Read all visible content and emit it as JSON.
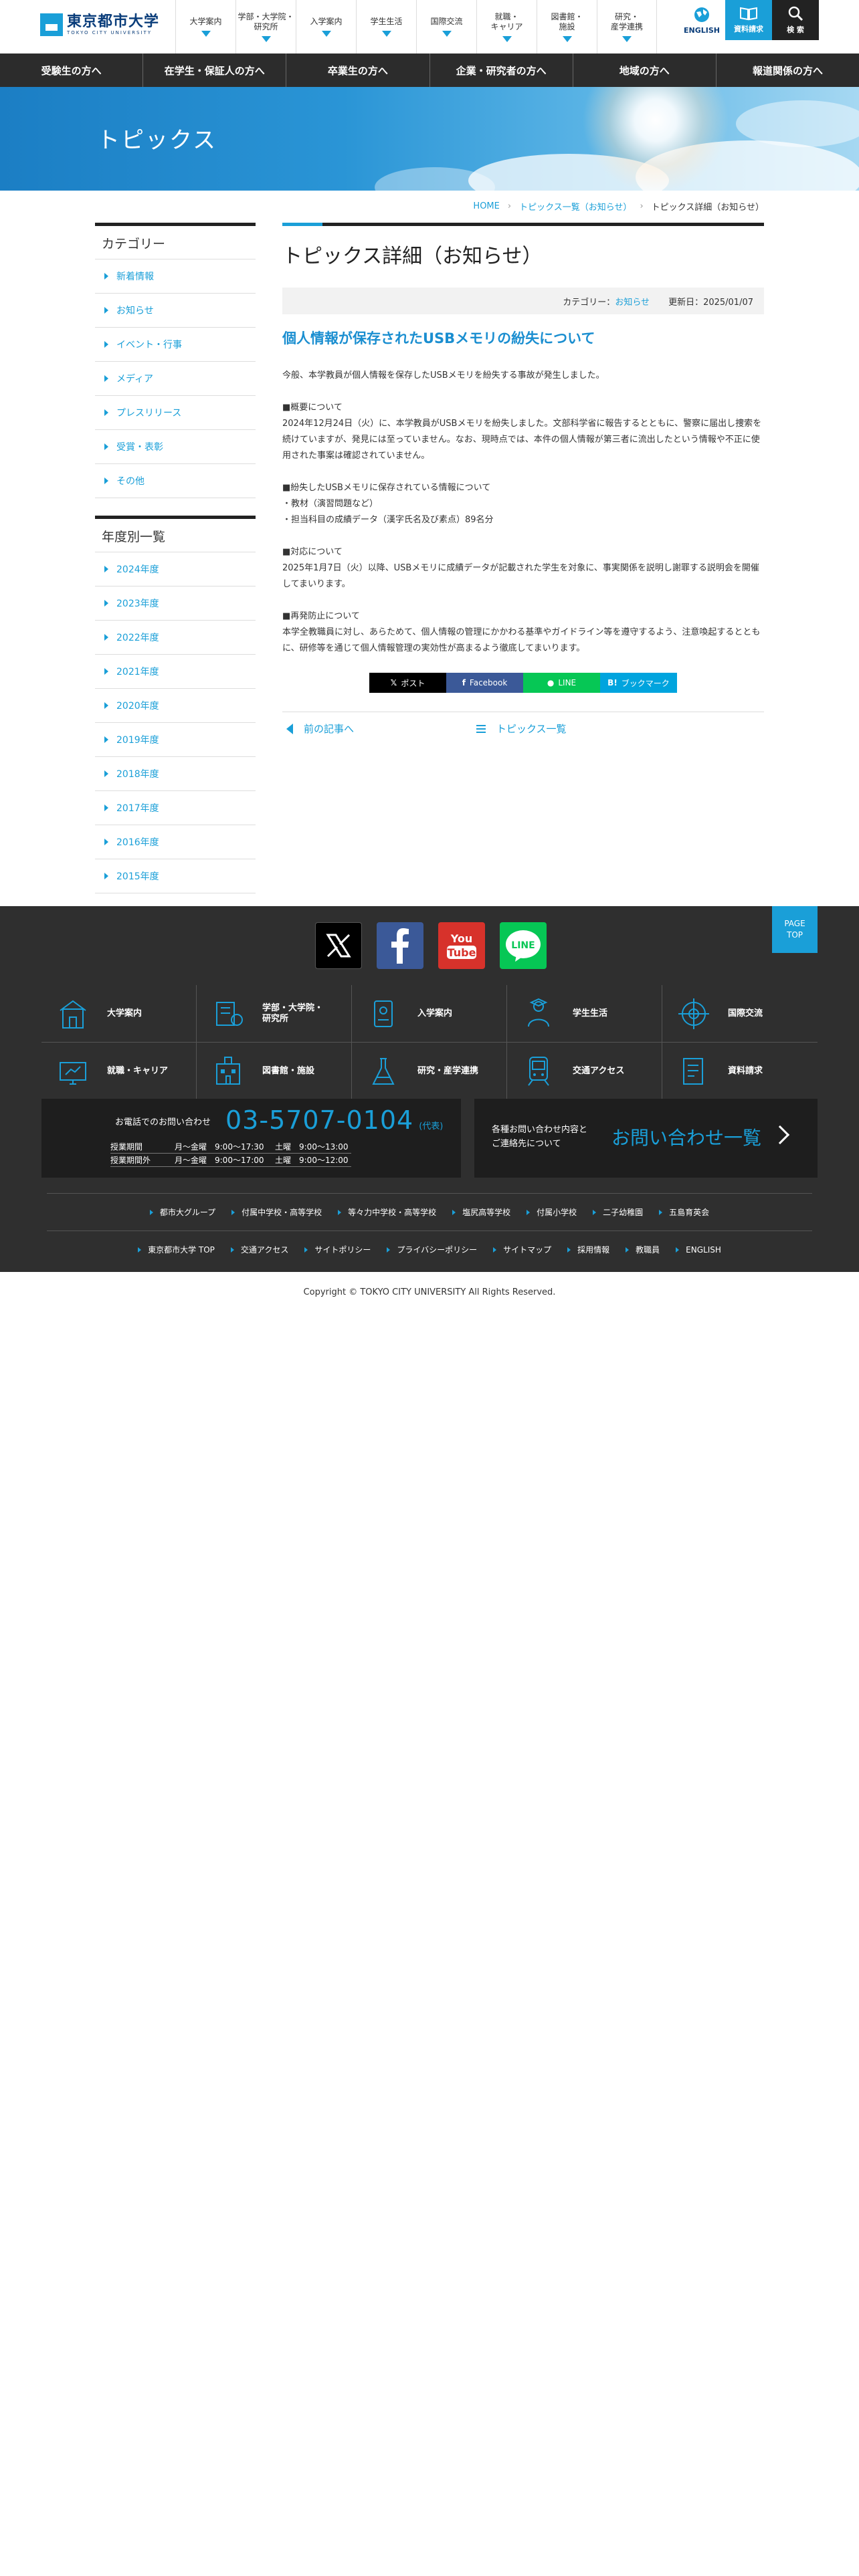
{
  "header": {
    "logo_jp": "東京都市大学",
    "logo_en": "TOKYO CITY UNIVERSITY",
    "nav": [
      {
        "label": "大学案内"
      },
      {
        "label": "学部・大学院・\n研究所"
      },
      {
        "label": "入学案内"
      },
      {
        "label": "学生生活"
      },
      {
        "label": "国際交流"
      },
      {
        "label": "就職・\nキャリア"
      },
      {
        "label": "図書館・\n施設"
      },
      {
        "label": "研究・\n産学連携"
      }
    ],
    "english_label": "ENGLISH",
    "request_label": "資料請求",
    "search_label": "検 索"
  },
  "subnav": [
    "受験生の方へ",
    "在学生・保証人の方へ",
    "卒業生の方へ",
    "企業・研究者の方へ",
    "地域の方へ",
    "報道関係の方へ"
  ],
  "hero": {
    "title": "トピックス"
  },
  "breadcrumb": [
    "HOME",
    "トピックス一覧（お知らせ）",
    "トピックス詳細（お知らせ）"
  ],
  "sidebar": {
    "category_title": "カテゴリー",
    "categories": [
      "新着情報",
      "お知らせ",
      "イベント・行事",
      "メディア",
      "プレスリリース",
      "受賞・表彰",
      "その他"
    ],
    "year_title": "年度別一覧",
    "years": [
      "2024年度",
      "2023年度",
      "2022年度",
      "2021年度",
      "2020年度",
      "2019年度",
      "2018年度",
      "2017年度",
      "2016年度",
      "2015年度"
    ]
  },
  "main": {
    "title": "トピックス詳細（お知らせ）",
    "category_label": "カテゴリー：",
    "category_value": "お知らせ",
    "updated": "更新日：2025/01/07",
    "headline": "個人情報が保存されたUSBメモリの紛失について",
    "paragraphs": [
      "今般、本学教員が個人情報を保存したUSBメモリを紛失する事故が発生しました。",
      "■概要について\n2024年12月24日（火）に、本学教員がUSBメモリを紛失しました。文部科学省に報告するとともに、警察に届出し捜索を続けていますが、発見には至っていません。なお、現時点では、本件の個人情報が第三者に流出したという情報や不正に使用された事案は確認されていません。",
      "■紛失したUSBメモリに保存されている情報について\n・教材（演習問題など）\n・担当科目の成績データ（漢字氏名及び素点）89名分",
      "■対応について\n2025年1月7日（火）以降、USBメモリに成績データが記載された学生を対象に、事実関係を説明し謝罪する説明会を開催してまいります。",
      "■再発防止について\n本学全教職員に対し、あらためて、個人情報の管理にかかわる基準やガイドライン等を遵守するよう、注意喚起するとともに、研修等を通じて個人情報管理の実効性が高まるよう徹底してまいります。"
    ],
    "share": {
      "x": "ポスト",
      "facebook": "Facebook",
      "line": "LINE",
      "hatena": "ブックマーク"
    },
    "prev_label": "前の記事へ",
    "list_label": "トピックス一覧"
  },
  "footer": {
    "pagetop": [
      "PAGE",
      "TOP"
    ],
    "grid": [
      {
        "label": "大学案内",
        "icon": "building-icon"
      },
      {
        "label": "学部・大学院・\n研究所",
        "icon": "faculty-icon"
      },
      {
        "label": "入学案内",
        "icon": "admission-icon"
      },
      {
        "label": "学生生活",
        "icon": "student-life-icon"
      },
      {
        "label": "国際交流",
        "icon": "globe-icon"
      },
      {
        "label": "就職・キャリア",
        "icon": "career-icon"
      },
      {
        "label": "図書館・施設",
        "icon": "library-icon"
      },
      {
        "label": "研究・産学連携",
        "icon": "flask-icon"
      },
      {
        "label": "交通アクセス",
        "icon": "train-icon"
      },
      {
        "label": "資料請求",
        "icon": "document-icon"
      }
    ],
    "contact_label": "お電話でのお問い合わせ",
    "tel": "03-5707-0104",
    "tel_note": "(代表)",
    "hours": [
      [
        "授業期間",
        "月〜金曜　9:00〜17:30",
        "土曜　9:00〜13:00"
      ],
      [
        "授業期間外",
        "月〜金曜　9:00〜17:00",
        "土曜　9:00〜12:00"
      ]
    ],
    "inquiry_label": "各種お問い合わせ内容と\nご連絡先について",
    "inquiry_big": "お問い合わせ一覧",
    "links1": [
      "都市大グループ",
      "付属中学校・高等学校",
      "等々力中学校・高等学校",
      "塩尻高等学校",
      "付属小学校",
      "二子幼稚園",
      "五島育英会"
    ],
    "links2": [
      "東京都市大学 TOP",
      "交通アクセス",
      "サイトポリシー",
      "プライバシーポリシー",
      "サイトマップ",
      "採用情報",
      "教職員",
      "ENGLISH"
    ]
  },
  "copyright": "Copyright © TOKYO CITY UNIVERSITY All Rights Reserved."
}
